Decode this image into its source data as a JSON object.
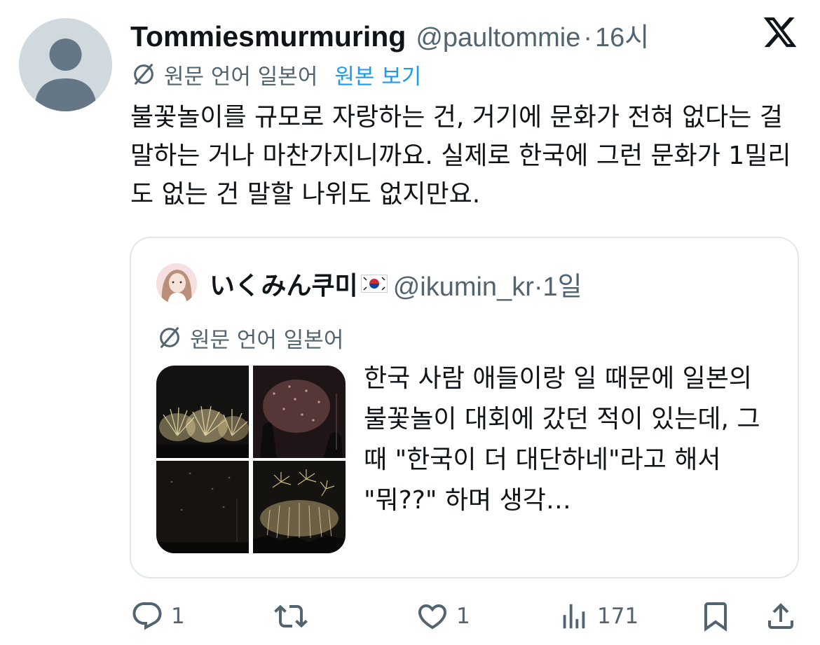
{
  "tweet": {
    "author": {
      "display_name": "Tommiesmurmuring",
      "handle": "@paultommie",
      "time": "16시"
    },
    "translation_label": "원문 언어 일본어",
    "view_original": "원본 보기",
    "text": "불꽃놀이를 규모로 자랑하는 건, 거기에 문화가 전혀 없다는 걸 말하는 거나 마찬가지니까요. 실제로 한국에 그런 문화가 1밀리도 없는 건 말할 나위도 없지만요."
  },
  "quote": {
    "author": {
      "display_name": "いくみん쿠미",
      "handle": "@ikumin_kr",
      "time": "1일"
    },
    "translation_label": "원문 언어 일본어",
    "text": "한국 사람 애들이랑 일 때문에 일본의 불꽃놀이 대회에 갔던 적이 있는데, 그때 \"한국이 더 대단하네\"라고 해서 \"뭐??\" 하며 생각…",
    "media_count": 4
  },
  "actions": {
    "replies": "1",
    "reposts": "",
    "likes": "1",
    "views": "171"
  },
  "icons": {
    "brand": "x-logo-icon",
    "translate": "translate-icon",
    "reply": "reply-icon",
    "repost": "repost-icon",
    "like": "heart-icon",
    "views": "views-icon",
    "bookmark": "bookmark-icon",
    "share": "share-icon"
  },
  "colors": {
    "accent": "#1d9bf0",
    "secondary_text": "#536471",
    "border": "#e1e8ed"
  }
}
